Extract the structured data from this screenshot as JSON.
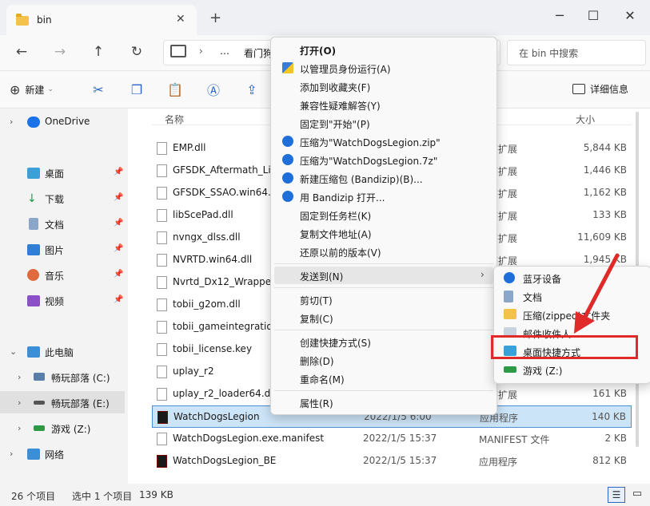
{
  "window": {
    "tab_title": "bin",
    "new_tab": "+",
    "minimize": "─",
    "maximize": "☐",
    "close": "✕"
  },
  "address": {
    "crumb_more": "…",
    "crumb_first": "看门狗",
    "search_placeholder": "在 bin 中搜索"
  },
  "toolbar": {
    "new_label": "新建",
    "details_label": "详细信息"
  },
  "sidebar": {
    "items": [
      {
        "label": "OneDrive"
      },
      {
        "label": "桌面"
      },
      {
        "label": "下载"
      },
      {
        "label": "文档"
      },
      {
        "label": "图片"
      },
      {
        "label": "音乐"
      },
      {
        "label": "视频"
      },
      {
        "label": "此电脑"
      },
      {
        "label": "畅玩部落 (C:)"
      },
      {
        "label": "畅玩部落 (E:)"
      },
      {
        "label": "游戏 (Z:)"
      },
      {
        "label": "网络"
      }
    ]
  },
  "filelist": {
    "col_name": "名称",
    "col_size": "大小",
    "rows": [
      {
        "name": "EMP.dll",
        "date": "",
        "type": "程序扩展",
        "size": "5,844 KB"
      },
      {
        "name": "GFSDK_Aftermath_Lib",
        "date": "",
        "type": "程序扩展",
        "size": "1,446 KB"
      },
      {
        "name": "GFSDK_SSAO.win64.d",
        "date": "",
        "type": "程序扩展",
        "size": "1,162 KB"
      },
      {
        "name": "libScePad.dll",
        "date": "",
        "type": "程序扩展",
        "size": "133 KB"
      },
      {
        "name": "nvngx_dlss.dll",
        "date": "",
        "type": "程序扩展",
        "size": "11,609 KB"
      },
      {
        "name": "NVRTD.win64.dll",
        "date": "",
        "type": "程序扩展",
        "size": "1,945 KB"
      },
      {
        "name": "Nvrtd_Dx12_Wrapper",
        "date": "",
        "type": "",
        "size": ""
      },
      {
        "name": "tobii_g2om.dll",
        "date": "",
        "type": "",
        "size": ""
      },
      {
        "name": "tobii_gameintegration",
        "date": "",
        "type": "",
        "size": ""
      },
      {
        "name": "tobii_license.key",
        "date": "",
        "type": "",
        "size": ""
      },
      {
        "name": "uplay_r2",
        "date": "",
        "type": "",
        "size": ""
      },
      {
        "name": "uplay_r2_loader64.dll",
        "date": "",
        "type": "程序扩展",
        "size": "161 KB"
      },
      {
        "name": "WatchDogsLegion",
        "date": "2022/1/5 6:00",
        "type": "应用程序",
        "size": "140 KB"
      },
      {
        "name": "WatchDogsLegion.exe.manifest",
        "date": "2022/1/5 15:37",
        "type": "MANIFEST 文件",
        "size": "2 KB"
      },
      {
        "name": "WatchDogsLegion_BE",
        "date": "2022/1/5 15:37",
        "type": "应用程序",
        "size": "812 KB"
      }
    ]
  },
  "status": {
    "count": "26 个项目",
    "selected": "选中 1 个项目",
    "size": "139 KB"
  },
  "context_menu": {
    "open": "打开(O)",
    "run_as_admin": "以管理员身份运行(A)",
    "add_favorites": "添加到收藏夹(F)",
    "troubleshoot": "兼容性疑难解答(Y)",
    "pin_start": "固定到\"开始\"(P)",
    "zip": "压缩为\"WatchDogsLegion.zip\"",
    "sevenz": "压缩为\"WatchDogsLegion.7z\"",
    "bandizip_new": "新建压缩包 (Bandizip)(B)...",
    "bandizip_open": "用 Bandizip 打开...",
    "pin_taskbar": "固定到任务栏(K)",
    "copy_path": "复制文件地址(A)",
    "restore": "还原以前的版本(V)",
    "send_to": "发送到(N)",
    "cut": "剪切(T)",
    "copy": "复制(C)",
    "create_shortcut": "创建快捷方式(S)",
    "delete": "删除(D)",
    "rename": "重命名(M)",
    "properties": "属性(R)"
  },
  "submenu": {
    "bluetooth": "蓝牙设备",
    "documents": "文档",
    "zip_folder": "压缩(zipped)文件夹",
    "mail": "邮件收件人",
    "desktop_shortcut": "桌面快捷方式",
    "games_drive": "游戏 (Z:)"
  },
  "colors": {
    "accent": "#2b66c3",
    "highlight": "#e02a2a",
    "selected_row": "#cce4f7"
  }
}
